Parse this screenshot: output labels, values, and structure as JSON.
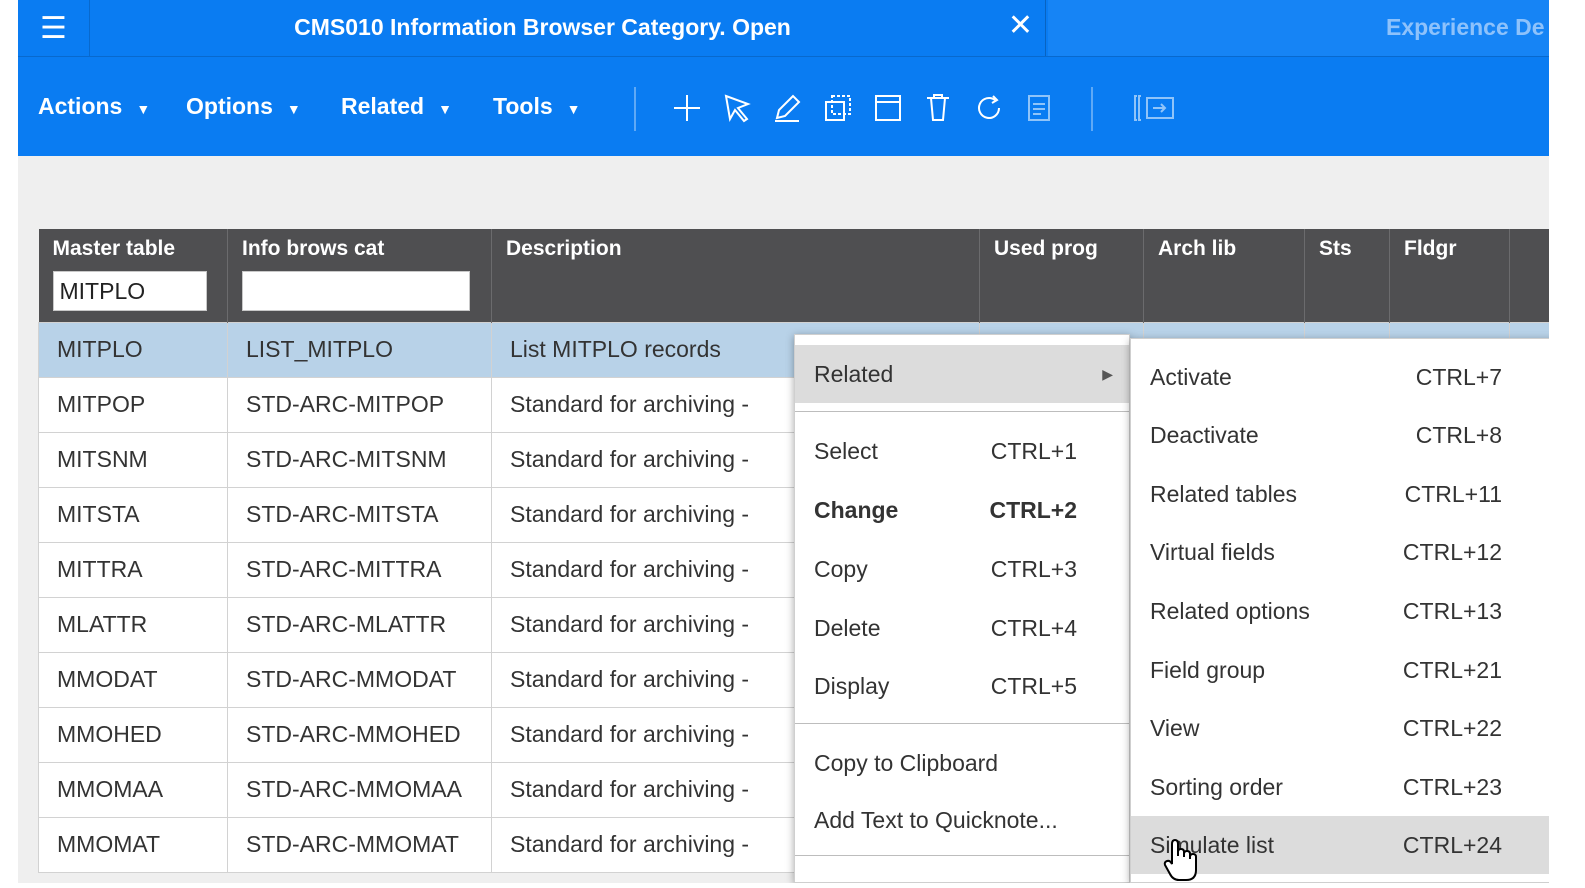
{
  "window": {
    "menu_icon": "hamburger-icon",
    "active_tab_title": "CMS010 Information Browser Category. Open",
    "other_tab_title": "Experience De"
  },
  "toolbar": {
    "menus": [
      {
        "label": "Actions"
      },
      {
        "label": "Options"
      },
      {
        "label": "Related"
      },
      {
        "label": "Tools"
      }
    ],
    "icons": [
      "plus-icon",
      "select-arrow-icon",
      "edit-pencil-icon",
      "copy-icon",
      "display-icon",
      "delete-icon",
      "refresh-icon",
      "note-icon",
      "panel-toggle-icon"
    ]
  },
  "grid": {
    "columns": [
      {
        "label": "Master table",
        "filter": "MITPLO"
      },
      {
        "label": "Info brows cat",
        "filter": ""
      },
      {
        "label": "Description"
      },
      {
        "label": "Used prog"
      },
      {
        "label": "Arch lib"
      },
      {
        "label": "Sts"
      },
      {
        "label": "Fldgr"
      }
    ],
    "rows": [
      {
        "master": "MITPLO",
        "cat": "LIST_MITPLO",
        "desc": "List MITPLO records"
      },
      {
        "master": "MITPOP",
        "cat": "STD-ARC-MITPOP",
        "desc": "Standard for archiving -"
      },
      {
        "master": "MITSNM",
        "cat": "STD-ARC-MITSNM",
        "desc": "Standard for archiving -"
      },
      {
        "master": "MITSTA",
        "cat": "STD-ARC-MITSTA",
        "desc": "Standard for archiving -"
      },
      {
        "master": "MITTRA",
        "cat": "STD-ARC-MITTRA",
        "desc": "Standard for archiving -"
      },
      {
        "master": "MLATTR",
        "cat": "STD-ARC-MLATTR",
        "desc": "Standard for archiving -"
      },
      {
        "master": "MMODAT",
        "cat": "STD-ARC-MMODAT",
        "desc": "Standard for archiving -"
      },
      {
        "master": "MMOHED",
        "cat": "STD-ARC-MMOHED",
        "desc": "Standard for archiving -"
      },
      {
        "master": "MMOMAA",
        "cat": "STD-ARC-MMOMAA",
        "desc": "Standard for archiving -"
      },
      {
        "master": "MMOMAT",
        "cat": "STD-ARC-MMOMAT",
        "desc": "Standard for archiving -"
      }
    ]
  },
  "context_menu": {
    "related": "Related",
    "items": [
      {
        "label": "Select",
        "key": "CTRL+1"
      },
      {
        "label": "Change",
        "key": "CTRL+2"
      },
      {
        "label": "Copy",
        "key": "CTRL+3"
      },
      {
        "label": "Delete",
        "key": "CTRL+4"
      },
      {
        "label": "Display",
        "key": "CTRL+5"
      }
    ],
    "extra": [
      {
        "label": "Copy to Clipboard"
      },
      {
        "label": "Add Text to Quicknote..."
      }
    ]
  },
  "submenu": {
    "items": [
      {
        "label": "Activate",
        "key": "CTRL+7"
      },
      {
        "label": "Deactivate",
        "key": "CTRL+8"
      },
      {
        "label": "Related tables",
        "key": "CTRL+11"
      },
      {
        "label": "Virtual fields",
        "key": "CTRL+12"
      },
      {
        "label": "Related options",
        "key": "CTRL+13"
      },
      {
        "label": "Field group",
        "key": "CTRL+21"
      },
      {
        "label": "View",
        "key": "CTRL+22"
      },
      {
        "label": "Sorting order",
        "key": "CTRL+23"
      },
      {
        "label": "Simulate list",
        "key": "CTRL+24"
      }
    ]
  },
  "colors": {
    "brand_blue": "#0a7cf2",
    "header_dark": "#4f4f51",
    "selected_row": "#b8d2e8",
    "menu_highlight": "#dcdcdc"
  }
}
